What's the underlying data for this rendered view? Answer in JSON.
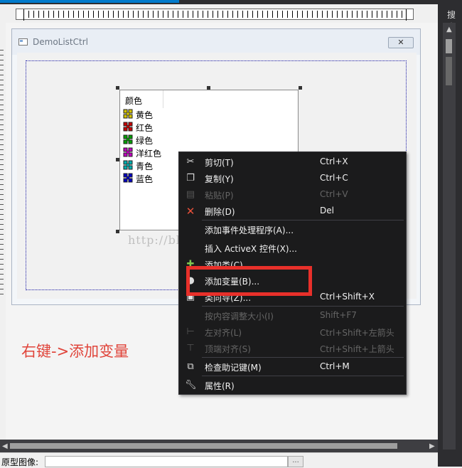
{
  "dialog": {
    "title": "DemoListCtrl",
    "close": "✕"
  },
  "list": {
    "header": "颜色",
    "items": [
      {
        "label": "黄色",
        "color": "#d4c400"
      },
      {
        "label": "红色",
        "color": "#c80000"
      },
      {
        "label": "绿色",
        "color": "#00a000"
      },
      {
        "label": "洋红色",
        "color": "#c000c0"
      },
      {
        "label": "青色",
        "color": "#00b0b0"
      },
      {
        "label": "蓝色",
        "color": "#0000c0"
      }
    ]
  },
  "menu": {
    "items": [
      {
        "label": "剪切(T)",
        "shortcut": "Ctrl+X",
        "icon": "scissors-icon",
        "disabled": false
      },
      {
        "label": "复制(Y)",
        "shortcut": "Ctrl+C",
        "icon": "copy-icon",
        "disabled": false
      },
      {
        "label": "粘贴(P)",
        "shortcut": "Ctrl+V",
        "icon": "paste-icon",
        "disabled": true
      },
      {
        "label": "删除(D)",
        "shortcut": "Del",
        "icon": "delete-icon",
        "disabled": false
      },
      {
        "label": "添加事件处理程序(A)...",
        "shortcut": "",
        "icon": "",
        "disabled": false
      },
      {
        "label": "插入 ActiveX 控件(X)...",
        "shortcut": "",
        "icon": "",
        "disabled": false
      },
      {
        "label": "添加类(C)...",
        "shortcut": "",
        "icon": "add-class-icon",
        "disabled": false
      },
      {
        "label": "添加变量(B)...",
        "shortcut": "",
        "icon": "add-variable-icon",
        "disabled": false
      },
      {
        "label": "类向导(Z)...",
        "shortcut": "Ctrl+Shift+X",
        "icon": "class-wizard-icon",
        "disabled": false
      },
      {
        "label": "按内容调整大小(I)",
        "shortcut": "Shift+F7",
        "icon": "",
        "disabled": true
      },
      {
        "label": "左对齐(L)",
        "shortcut": "Ctrl+Shift+左箭头",
        "icon": "align-left-icon",
        "disabled": true
      },
      {
        "label": "顶端对齐(S)",
        "shortcut": "Ctrl+Shift+上箭头",
        "icon": "align-top-icon",
        "disabled": true
      },
      {
        "label": "检查助记键(M)",
        "shortcut": "Ctrl+M",
        "icon": "mnemonic-icon",
        "disabled": false
      },
      {
        "label": "属性(R)",
        "shortcut": "",
        "icon": "wrench-icon",
        "disabled": false
      }
    ]
  },
  "annotation": "右键->添加变量",
  "watermark": "http://blog.csdn.net/wingceltis",
  "right_panel": {
    "label": "搜索"
  },
  "bottom": {
    "label": "原型图像:",
    "button": "..."
  },
  "colors": {
    "menu_bg": "#1b1b1c",
    "highlight": "#e8302a",
    "annotation": "#e0443a",
    "accent": "#007acc"
  }
}
